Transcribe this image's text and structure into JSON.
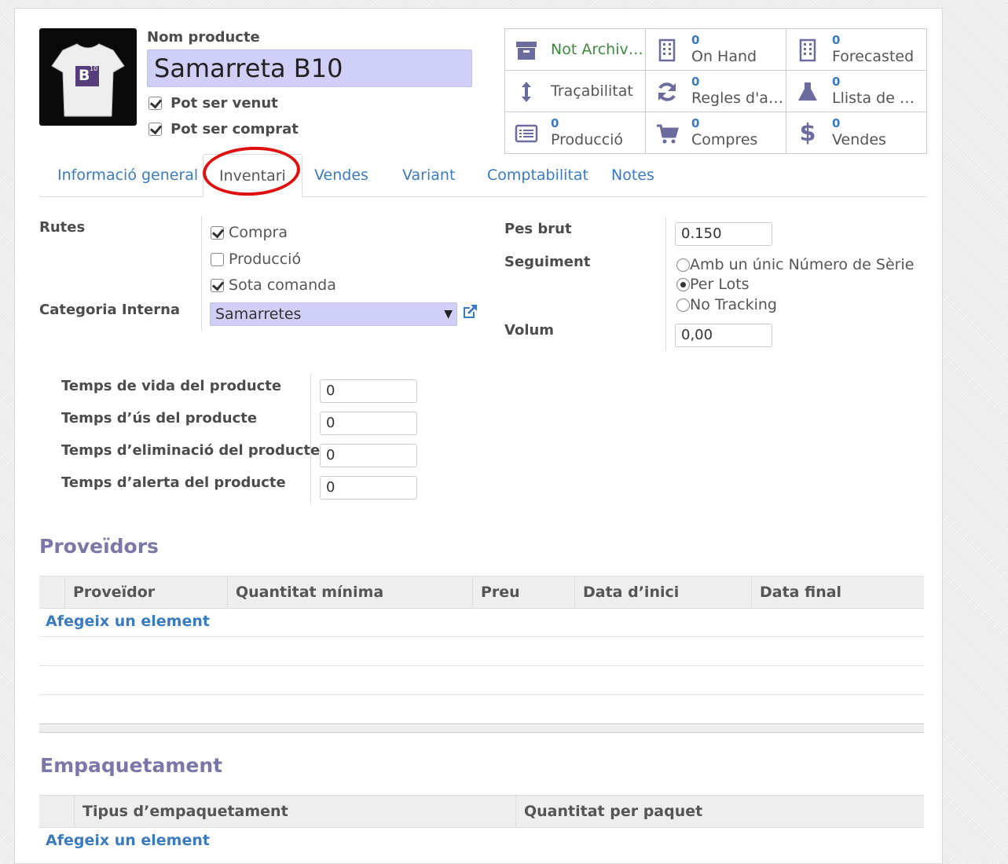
{
  "product": {
    "name_label": "Nom producte",
    "name": "Samarreta B10",
    "can_be_sold_label": "Pot ser venut",
    "can_be_sold": true,
    "can_be_purchased_label": "Pot ser comprat",
    "can_be_purchased": true,
    "image_badge": "B",
    "image_badge_sup": "10"
  },
  "smart_buttons": [
    {
      "icon": "archive-icon",
      "count": "",
      "label": "Not Archived"
    },
    {
      "icon": "building-icon",
      "count": "0",
      "label": "On Hand"
    },
    {
      "icon": "building-icon",
      "count": "0",
      "label": "Forecasted"
    },
    {
      "icon": "arrows-vertical-icon",
      "count": "",
      "label": "Traçabilitat"
    },
    {
      "icon": "refresh-icon",
      "count": "0",
      "label": "Regles d'aba..."
    },
    {
      "icon": "flask-icon",
      "count": "0",
      "label": "Llista de mat..."
    },
    {
      "icon": "list-icon",
      "count": "0",
      "label": "Producció"
    },
    {
      "icon": "cart-icon",
      "count": "0",
      "label": "Compres"
    },
    {
      "icon": "dollar-icon",
      "count": "0",
      "label": "Vendes"
    }
  ],
  "tabs": [
    {
      "label": "Informació general",
      "active": false
    },
    {
      "label": "Inventari",
      "active": true
    },
    {
      "label": "Vendes",
      "active": false
    },
    {
      "label": "Variant",
      "active": false
    },
    {
      "label": "Comptabilitat",
      "active": false
    },
    {
      "label": "Notes",
      "active": false
    }
  ],
  "inventory": {
    "routes_label": "Rutes",
    "routes": [
      {
        "label": "Compra",
        "checked": true
      },
      {
        "label": "Producció",
        "checked": false
      },
      {
        "label": "Sota comanda",
        "checked": true
      }
    ],
    "category_label": "Categoria Interna",
    "category": "Samarretes",
    "weight_label": "Pes brut",
    "weight": "0.150",
    "tracking_label": "Seguiment",
    "tracking_options": [
      {
        "label": "Amb un únic Número de Sèrie",
        "selected": false
      },
      {
        "label": "Per Lots",
        "selected": true
      },
      {
        "label": "No Tracking",
        "selected": false
      }
    ],
    "volume_label": "Volum",
    "volume": "0,00",
    "life_fields": [
      {
        "label": "Temps de vida del producte",
        "value": "0"
      },
      {
        "label": "Temps d’ús del producte",
        "value": "0"
      },
      {
        "label": "Temps d’eliminació del producte",
        "value": "0"
      },
      {
        "label": "Temps d’alerta del producte",
        "value": "0"
      }
    ]
  },
  "vendors": {
    "title": "Proveïdors",
    "columns": [
      "Proveïdor",
      "Quantitat mínima",
      "Preu",
      "Data d’inici",
      "Data final"
    ],
    "add_label": "Afegeix un element"
  },
  "packaging": {
    "title": "Empaquetament",
    "columns": [
      "Tipus d’empaquetament",
      "Quantitat per paquet"
    ],
    "add_label": "Afegeix un element"
  },
  "colors": {
    "link": "#3a7bbf",
    "section_title": "#7b77a8",
    "required_field": "#cfcff7",
    "annotation_circle": "#e01010"
  }
}
